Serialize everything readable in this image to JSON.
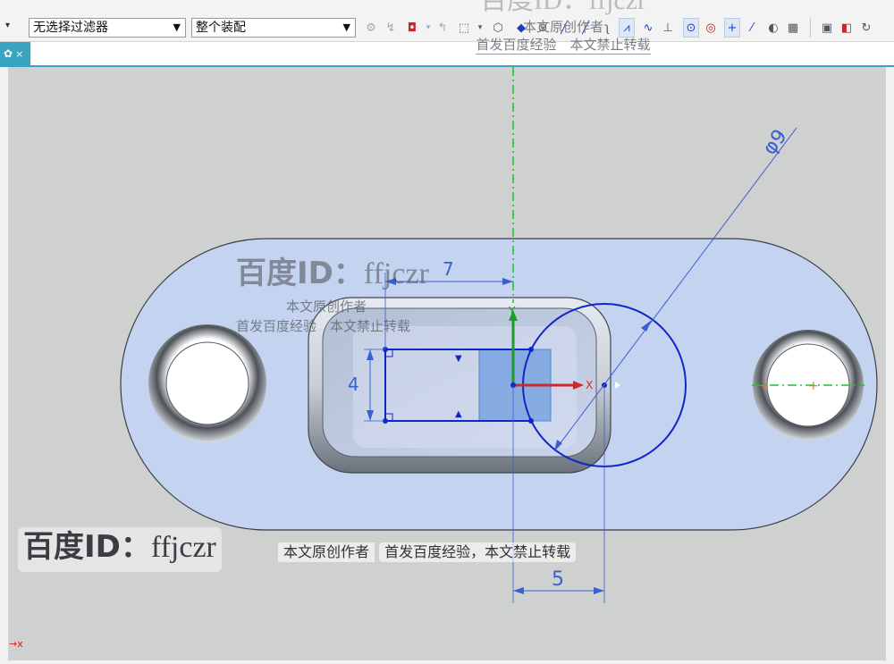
{
  "toolbar": {
    "selection_filter": "无选择过滤器",
    "scope": "整个装配"
  },
  "tab": {
    "active_label": "✿",
    "close_glyph": "×"
  },
  "sketch": {
    "dim_diameter": "φ9",
    "dim_width": "7",
    "dim_height": "4",
    "dim_offset": "5",
    "axis_y": "Y",
    "axis_x": "X"
  },
  "watermarks": {
    "top_title": "百度ID：ffjczr",
    "top_line1": "本文原创作者",
    "top_line2": "首发百度经验　本文禁止转载",
    "mid_title_cn": "百度ID：",
    "mid_title_en": "ffjczr",
    "mid_line1": "本文原创作者",
    "mid_line2": "首发百度经验　本文禁止转载",
    "bottom_title_cn": "百度ID：",
    "bottom_title_en": "ffjczr",
    "bottom_line1": "本文原创作者",
    "bottom_line2": "首发百度经验，本文禁止转载"
  },
  "status": {
    "axis_indicator": "→x"
  },
  "colors": {
    "viewport_bg": "#cfd0d0",
    "part_fill": "#c4d3ef",
    "sketch_blue": "#1026c8",
    "tab_accent": "#3aa3c0"
  }
}
